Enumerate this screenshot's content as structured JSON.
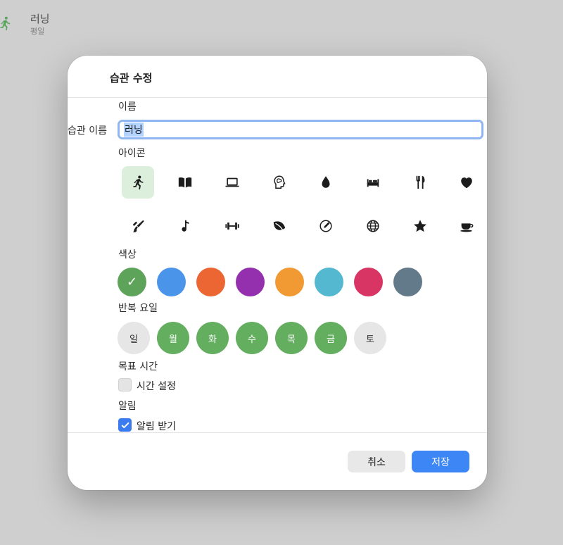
{
  "background": {
    "habit_title": "러닝",
    "habit_subtitle": "평일",
    "habit_icon": "figure-run-icon"
  },
  "dialog": {
    "title": "습관 수정",
    "name_section": "이름",
    "name_label": "습관 이름",
    "name_value": "러닝",
    "icon_section": "아이콘",
    "icons": [
      "figure-run-icon",
      "book-icon",
      "laptop-icon",
      "brain-head-icon",
      "drop-icon",
      "bed-icon",
      "fork-knife-icon",
      "heart-icon",
      "paintbrush-icon",
      "music-note-icon",
      "dumbbell-icon",
      "leaf-icon",
      "pencil-circle-icon",
      "globe-icon",
      "star-icon",
      "cup-icon"
    ],
    "selected_icon": "figure-run-icon",
    "color_section": "색상",
    "colors": [
      "#5ea35a",
      "#4a95ea",
      "#ec6634",
      "#942fae",
      "#f19a34",
      "#54b8d0",
      "#d83565",
      "#637a8b"
    ],
    "selected_color": "#5ea35a",
    "repeat_section": "반복 요일",
    "days": [
      {
        "label": "일",
        "active": false
      },
      {
        "label": "월",
        "active": true
      },
      {
        "label": "화",
        "active": true
      },
      {
        "label": "수",
        "active": true
      },
      {
        "label": "목",
        "active": true
      },
      {
        "label": "금",
        "active": true
      },
      {
        "label": "토",
        "active": false
      }
    ],
    "goal_section": "목표 시간",
    "time_setting_label": "시간 설정",
    "time_setting_checked": false,
    "alarm_section": "알림",
    "alarm_label": "알림 받기",
    "alarm_checked": true,
    "cancel_label": "취소",
    "save_label": "저장",
    "accent_color": "#3d86f6"
  }
}
